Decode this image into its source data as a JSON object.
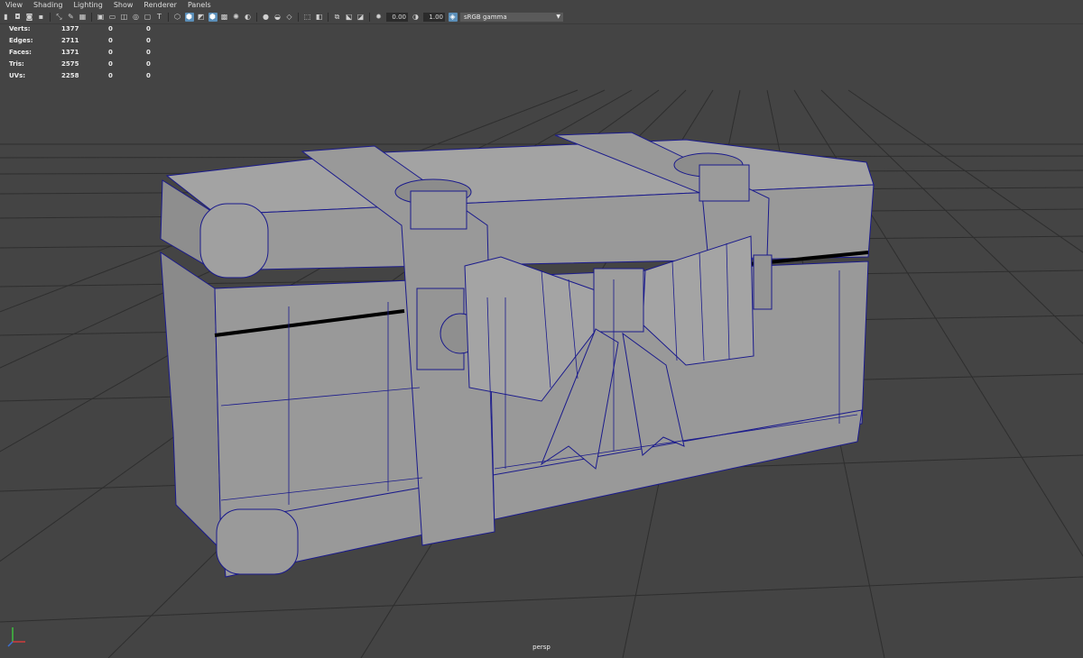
{
  "menu": {
    "items": [
      "View",
      "Shading",
      "Lighting",
      "Show",
      "Renderer",
      "Panels"
    ]
  },
  "toolbar": {
    "exposure_value": "0.00",
    "gamma_value": "1.00",
    "color_space": "sRGB gamma"
  },
  "hud": {
    "rows": [
      {
        "label": "Verts:",
        "v1": "1377",
        "v2": "0",
        "v3": "0"
      },
      {
        "label": "Edges:",
        "v1": "2711",
        "v2": "0",
        "v3": "0"
      },
      {
        "label": "Faces:",
        "v1": "1371",
        "v2": "0",
        "v3": "0"
      },
      {
        "label": "Tris:",
        "v1": "2575",
        "v2": "0",
        "v3": "0"
      },
      {
        "label": "UVs:",
        "v1": "2258",
        "v2": "0",
        "v3": "0"
      }
    ]
  },
  "viewport": {
    "camera_name": "persp",
    "wire_color": "#1a1a8c",
    "model_color": "#999999",
    "grid_color": "#2e2e2e"
  }
}
